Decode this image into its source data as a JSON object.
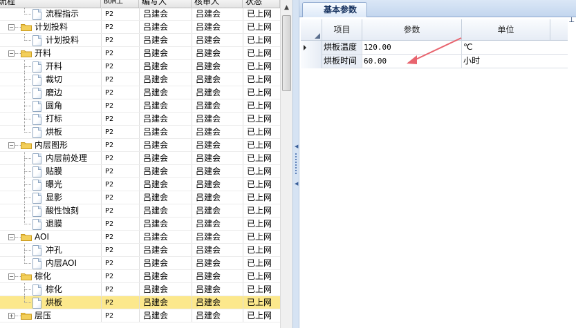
{
  "tree_grid": {
    "columns": [
      {
        "key": "name",
        "label": "流程"
      },
      {
        "key": "bom",
        "label": "BOM工"
      },
      {
        "key": "editor",
        "label": "编写人"
      },
      {
        "key": "reviewer",
        "label": "核审人"
      },
      {
        "key": "status",
        "label": "状态"
      }
    ],
    "rows": [
      {
        "level": 1,
        "type": "doc",
        "name": "流程指示",
        "bom": "P2",
        "editor": "吕建会",
        "reviewer": "吕建会",
        "status": "已上网",
        "last": true
      },
      {
        "level": 0,
        "type": "folder",
        "name": "计划投料",
        "bom": "P2",
        "editor": "吕建会",
        "reviewer": "吕建会",
        "status": "已上网",
        "expanded": true
      },
      {
        "level": 1,
        "type": "doc",
        "name": "计划投料",
        "bom": "P2",
        "editor": "吕建会",
        "reviewer": "吕建会",
        "status": "已上网",
        "last": true
      },
      {
        "level": 0,
        "type": "folder",
        "name": "开料",
        "bom": "P2",
        "editor": "吕建会",
        "reviewer": "吕建会",
        "status": "已上网",
        "expanded": true
      },
      {
        "level": 1,
        "type": "doc",
        "name": "开料",
        "bom": "P2",
        "editor": "吕建会",
        "reviewer": "吕建会",
        "status": "已上网"
      },
      {
        "level": 1,
        "type": "doc",
        "name": "裁切",
        "bom": "P2",
        "editor": "吕建会",
        "reviewer": "吕建会",
        "status": "已上网"
      },
      {
        "level": 1,
        "type": "doc",
        "name": "磨边",
        "bom": "P2",
        "editor": "吕建会",
        "reviewer": "吕建会",
        "status": "已上网"
      },
      {
        "level": 1,
        "type": "doc",
        "name": "圆角",
        "bom": "P2",
        "editor": "吕建会",
        "reviewer": "吕建会",
        "status": "已上网"
      },
      {
        "level": 1,
        "type": "doc",
        "name": "打标",
        "bom": "P2",
        "editor": "吕建会",
        "reviewer": "吕建会",
        "status": "已上网"
      },
      {
        "level": 1,
        "type": "doc",
        "name": "烘板",
        "bom": "P2",
        "editor": "吕建会",
        "reviewer": "吕建会",
        "status": "已上网",
        "last": true
      },
      {
        "level": 0,
        "type": "folder",
        "name": "内层图形",
        "bom": "P2",
        "editor": "吕建会",
        "reviewer": "吕建会",
        "status": "已上网",
        "expanded": true
      },
      {
        "level": 1,
        "type": "doc",
        "name": "内层前处理",
        "bom": "P2",
        "editor": "吕建会",
        "reviewer": "吕建会",
        "status": "已上网"
      },
      {
        "level": 1,
        "type": "doc",
        "name": "贴膜",
        "bom": "P2",
        "editor": "吕建会",
        "reviewer": "吕建会",
        "status": "已上网"
      },
      {
        "level": 1,
        "type": "doc",
        "name": "曝光",
        "bom": "P2",
        "editor": "吕建会",
        "reviewer": "吕建会",
        "status": "已上网"
      },
      {
        "level": 1,
        "type": "doc",
        "name": "显影",
        "bom": "P2",
        "editor": "吕建会",
        "reviewer": "吕建会",
        "status": "已上网"
      },
      {
        "level": 1,
        "type": "doc",
        "name": "酸性蚀刻",
        "bom": "P2",
        "editor": "吕建会",
        "reviewer": "吕建会",
        "status": "已上网"
      },
      {
        "level": 1,
        "type": "doc",
        "name": "退膜",
        "bom": "P2",
        "editor": "吕建会",
        "reviewer": "吕建会",
        "status": "已上网",
        "last": true
      },
      {
        "level": 0,
        "type": "folder",
        "name": "AOI",
        "bom": "P2",
        "editor": "吕建会",
        "reviewer": "吕建会",
        "status": "已上网",
        "expanded": true
      },
      {
        "level": 1,
        "type": "doc",
        "name": "冲孔",
        "bom": "P2",
        "editor": "吕建会",
        "reviewer": "吕建会",
        "status": "已上网"
      },
      {
        "level": 1,
        "type": "doc",
        "name": "内层AOI",
        "bom": "P2",
        "editor": "吕建会",
        "reviewer": "吕建会",
        "status": "已上网",
        "last": true
      },
      {
        "level": 0,
        "type": "folder",
        "name": "棕化",
        "bom": "P2",
        "editor": "吕建会",
        "reviewer": "吕建会",
        "status": "已上网",
        "expanded": true
      },
      {
        "level": 1,
        "type": "doc",
        "name": "棕化",
        "bom": "P2",
        "editor": "吕建会",
        "reviewer": "吕建会",
        "status": "已上网"
      },
      {
        "level": 1,
        "type": "doc",
        "name": "烘板",
        "bom": "P2",
        "editor": "吕建会",
        "reviewer": "吕建会",
        "status": "已上网",
        "selected": true,
        "last": true
      },
      {
        "level": 0,
        "type": "folder",
        "name": "层压",
        "bom": "P2",
        "editor": "吕建会",
        "reviewer": "吕建会",
        "status": "已上网",
        "expanded": false
      }
    ]
  },
  "right_panel": {
    "tab_label": "基本参数",
    "pin_glyph": "⊥",
    "grid": {
      "headers": {
        "item": "项目",
        "param": "参数",
        "unit": "单位"
      },
      "rows": [
        {
          "item": "烘板温度",
          "param": "120.00",
          "unit": "℃",
          "current": true
        },
        {
          "item": "烘板时间",
          "param": "60.00",
          "unit": "小时",
          "current": false
        }
      ]
    }
  },
  "colors": {
    "selection": "#fce88c",
    "annotation_arrow": "#e8646e",
    "splitter": "#d6e3f3"
  }
}
